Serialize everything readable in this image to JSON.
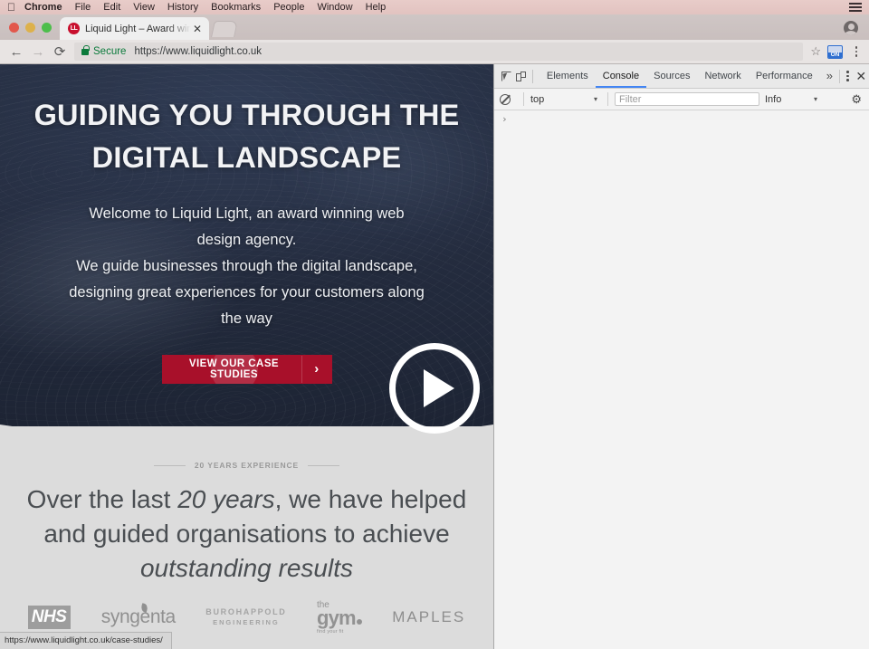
{
  "menubar": {
    "apple_glyph": "●",
    "items": [
      {
        "label": "Chrome",
        "bold": true
      },
      {
        "label": "File",
        "bold": false
      },
      {
        "label": "Edit",
        "bold": false
      },
      {
        "label": "View",
        "bold": false
      },
      {
        "label": "History",
        "bold": false
      },
      {
        "label": "Bookmarks",
        "bold": false
      },
      {
        "label": "People",
        "bold": false
      },
      {
        "label": "Window",
        "bold": false
      },
      {
        "label": "Help",
        "bold": false
      }
    ],
    "status_icon": "list-icon"
  },
  "browser": {
    "tab": {
      "favicon_text": "LL",
      "title": "Liquid Light – Award winning",
      "close_glyph": "✕"
    },
    "new_tab_icon": "new-tab-icon",
    "profile_icon": "profile-avatar-icon",
    "toolbar": {
      "back_glyph": "←",
      "forward_glyph": "→",
      "reload_glyph": "⟳",
      "secure_label": "Secure",
      "url": "https://www.liquidlight.co.uk",
      "bookmark_glyph": "☆",
      "extension_badge": "ON",
      "menu_icon": "chrome-menu-icon"
    },
    "status_bubble": "https://www.liquidlight.co.uk/case-studies/"
  },
  "site": {
    "hero": {
      "title_line1": "GUIDING YOU THROUGH THE",
      "title_line2": "DIGITAL LANDSCAPE",
      "paragraph_line1": "Welcome to Liquid Light, an award winning web",
      "paragraph_line2": "design agency.",
      "paragraph_line3": "We guide businesses through the digital landscape,",
      "paragraph_line4": "designing great experiences for your customers along",
      "paragraph_line5": "the way",
      "cta_label": "VIEW OUR CASE STUDIES",
      "cta_chevron": "›",
      "play_button_icon": "play-icon",
      "bg_color": "#232b3d",
      "cta_color": "#a8102a"
    },
    "stats": {
      "eyebrow": "20 YEARS EXPERIENCE",
      "headline_part1": "Over the last ",
      "headline_em1": "20 years",
      "headline_part2": ", we have helped",
      "headline_line2": "and guided organisations to achieve",
      "headline_em2": "outstanding results",
      "logos": [
        {
          "name": "NHS",
          "text": "NHS"
        },
        {
          "name": "syngenta",
          "text": "syngenta"
        },
        {
          "name": "burohappold",
          "text": "BUROHAPPOLD",
          "sub": "ENGINEERING"
        },
        {
          "name": "the-gym",
          "the": "the",
          "text": "gym",
          "tagline": "find your fit"
        },
        {
          "name": "maples",
          "text": "MAPLES"
        }
      ]
    }
  },
  "devtools": {
    "inspect_icon": "inspect-element-icon",
    "device_icon": "device-toolbar-icon",
    "tabs": [
      {
        "label": "Elements",
        "active": false
      },
      {
        "label": "Console",
        "active": true
      },
      {
        "label": "Sources",
        "active": false
      },
      {
        "label": "Network",
        "active": false
      },
      {
        "label": "Performance",
        "active": false
      }
    ],
    "overflow_glyph": "»",
    "menu_icon": "devtools-menu-icon",
    "close_glyph": "✕",
    "filterbar": {
      "clear_icon": "clear-console-icon",
      "context": "top",
      "context_caret": "▾",
      "filter_placeholder": "Filter",
      "level": "Info",
      "level_caret": "▾",
      "settings_icon": "⚙"
    },
    "console_prompt": "›"
  }
}
